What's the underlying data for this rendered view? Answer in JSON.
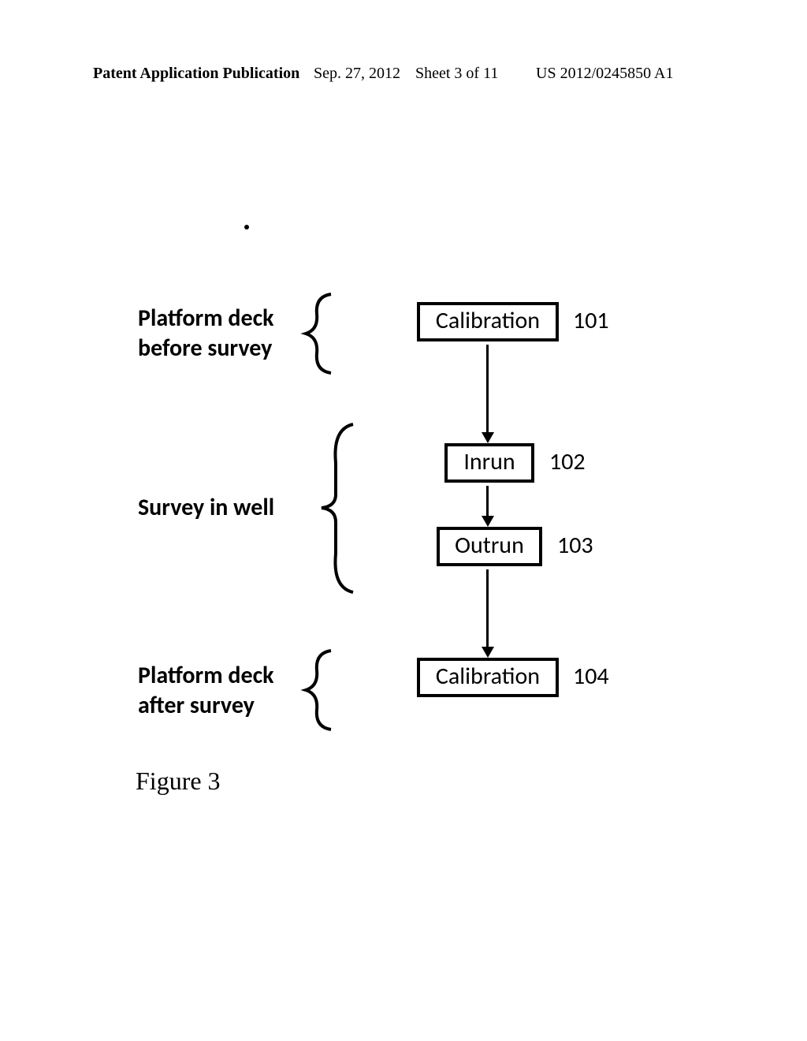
{
  "header": {
    "publication": "Patent Application Publication",
    "date": "Sep. 27, 2012",
    "sheet": "Sheet 3 of 11",
    "docno": "US 2012/0245850 A1"
  },
  "phases": {
    "p1_line1": "Platform deck",
    "p1_line2": "before survey",
    "p2": "Survey in well",
    "p3_line1": "Platform deck",
    "p3_line2": "after survey"
  },
  "boxes": {
    "b1": "Calibration",
    "b2": "Inrun",
    "b3": "Outrun",
    "b4": "Calibration"
  },
  "refs": {
    "r101": "101",
    "r102": "102",
    "r103": "103",
    "r104": "104"
  },
  "caption": "Figure 3",
  "chart_data": {
    "type": "table",
    "title": "Figure 3 — survey procedure flow",
    "phases": [
      {
        "phase": "Platform deck before survey",
        "steps": [
          {
            "ref": 101,
            "label": "Calibration"
          }
        ]
      },
      {
        "phase": "Survey in well",
        "steps": [
          {
            "ref": 102,
            "label": "Inrun"
          },
          {
            "ref": 103,
            "label": "Outrun"
          }
        ]
      },
      {
        "phase": "Platform deck after survey",
        "steps": [
          {
            "ref": 104,
            "label": "Calibration"
          }
        ]
      }
    ],
    "flow": [
      101,
      102,
      103,
      104
    ]
  }
}
